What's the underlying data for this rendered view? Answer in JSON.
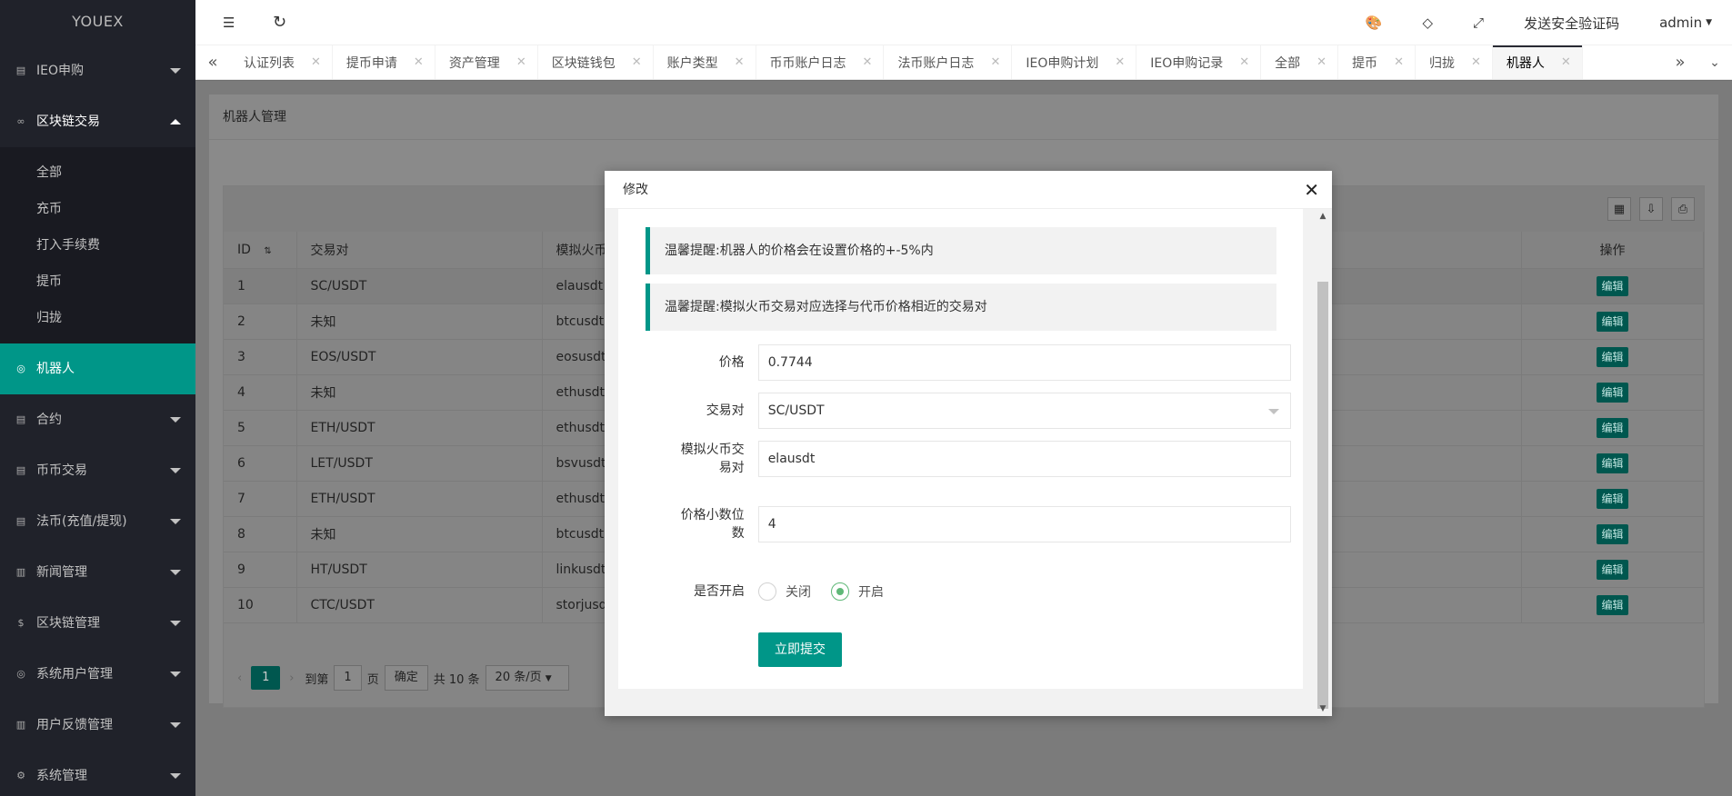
{
  "brand": "YOUEX",
  "sidebar": {
    "items": [
      {
        "label": "IEO申购",
        "icon": "document-icon"
      },
      {
        "label": "区块链交易",
        "icon": "link-icon"
      },
      {
        "label": "机器人",
        "icon": "user-icon"
      },
      {
        "label": "合约",
        "icon": "document-icon"
      },
      {
        "label": "币币交易",
        "icon": "document-icon"
      },
      {
        "label": "法币(充值/提现)",
        "icon": "document-icon"
      },
      {
        "label": "新闻管理",
        "icon": "news-icon"
      },
      {
        "label": "区块链管理",
        "icon": "dollar-icon"
      },
      {
        "label": "系统用户管理",
        "icon": "user-icon"
      },
      {
        "label": "用户反馈管理",
        "icon": "news-icon"
      },
      {
        "label": "系统管理",
        "icon": "gear-icon"
      }
    ],
    "sub_items": [
      "全部",
      "充币",
      "打入手续费",
      "提币",
      "归拢"
    ]
  },
  "header": {
    "send_code": "发送安全验证码",
    "user": "admin"
  },
  "tabs": [
    "认证列表",
    "提币申请",
    "资产管理",
    "区块链钱包",
    "账户类型",
    "币币账户日志",
    "法币账户日志",
    "IEO申购计划",
    "IEO申购记录",
    "全部",
    "提币",
    "归拢",
    "机器人"
  ],
  "page": {
    "title": "机器人管理",
    "columns": [
      "ID",
      "交易对",
      "模拟火币",
      "操作"
    ],
    "rows": [
      {
        "id": "1",
        "pair": "SC/USDT",
        "sim": "elausdt"
      },
      {
        "id": "2",
        "pair": "未知",
        "sim": "btcusdt"
      },
      {
        "id": "3",
        "pair": "EOS/USDT",
        "sim": "eosusdt"
      },
      {
        "id": "4",
        "pair": "未知",
        "sim": "ethusdt"
      },
      {
        "id": "5",
        "pair": "ETH/USDT",
        "sim": "ethusdt"
      },
      {
        "id": "6",
        "pair": "LET/USDT",
        "sim": "bsvusdt"
      },
      {
        "id": "7",
        "pair": "ETH/USDT",
        "sim": "ethusdt"
      },
      {
        "id": "8",
        "pair": "未知",
        "sim": "btcusdt"
      },
      {
        "id": "9",
        "pair": "HT/USDT",
        "sim": "linkusdt"
      },
      {
        "id": "10",
        "pair": "CTC/USDT",
        "sim": "storjusdt"
      }
    ],
    "edit_label": "编辑",
    "pager": {
      "current": "1",
      "goto": "到第",
      "page_input": "1",
      "page_unit": "页",
      "confirm": "确定",
      "total": "共 10 条",
      "per_page": "20 条/页"
    }
  },
  "modal": {
    "title": "修改",
    "notice1": "温馨提醒:机器人的价格会在设置价格的+-5%内",
    "notice2": "温馨提醒:模拟火币交易对应选择与代币价格相近的交易对",
    "fields": {
      "price_label": "价格",
      "price_value": "0.7744",
      "pair_label": "交易对",
      "pair_value": "SC/USDT",
      "sim_label_1": "模拟火币交",
      "sim_label_2": "易对",
      "sim_value": "elausdt",
      "decimals_label_1": "价格小数位",
      "decimals_label_2": "数",
      "decimals_value": "4",
      "open_label": "是否开启",
      "off_label": "关闭",
      "on_label": "开启"
    },
    "submit": "立即提交"
  },
  "colors": {
    "accent": "#009688",
    "sidebar_bg": "#20222a",
    "radio_green": "#5FB878"
  }
}
